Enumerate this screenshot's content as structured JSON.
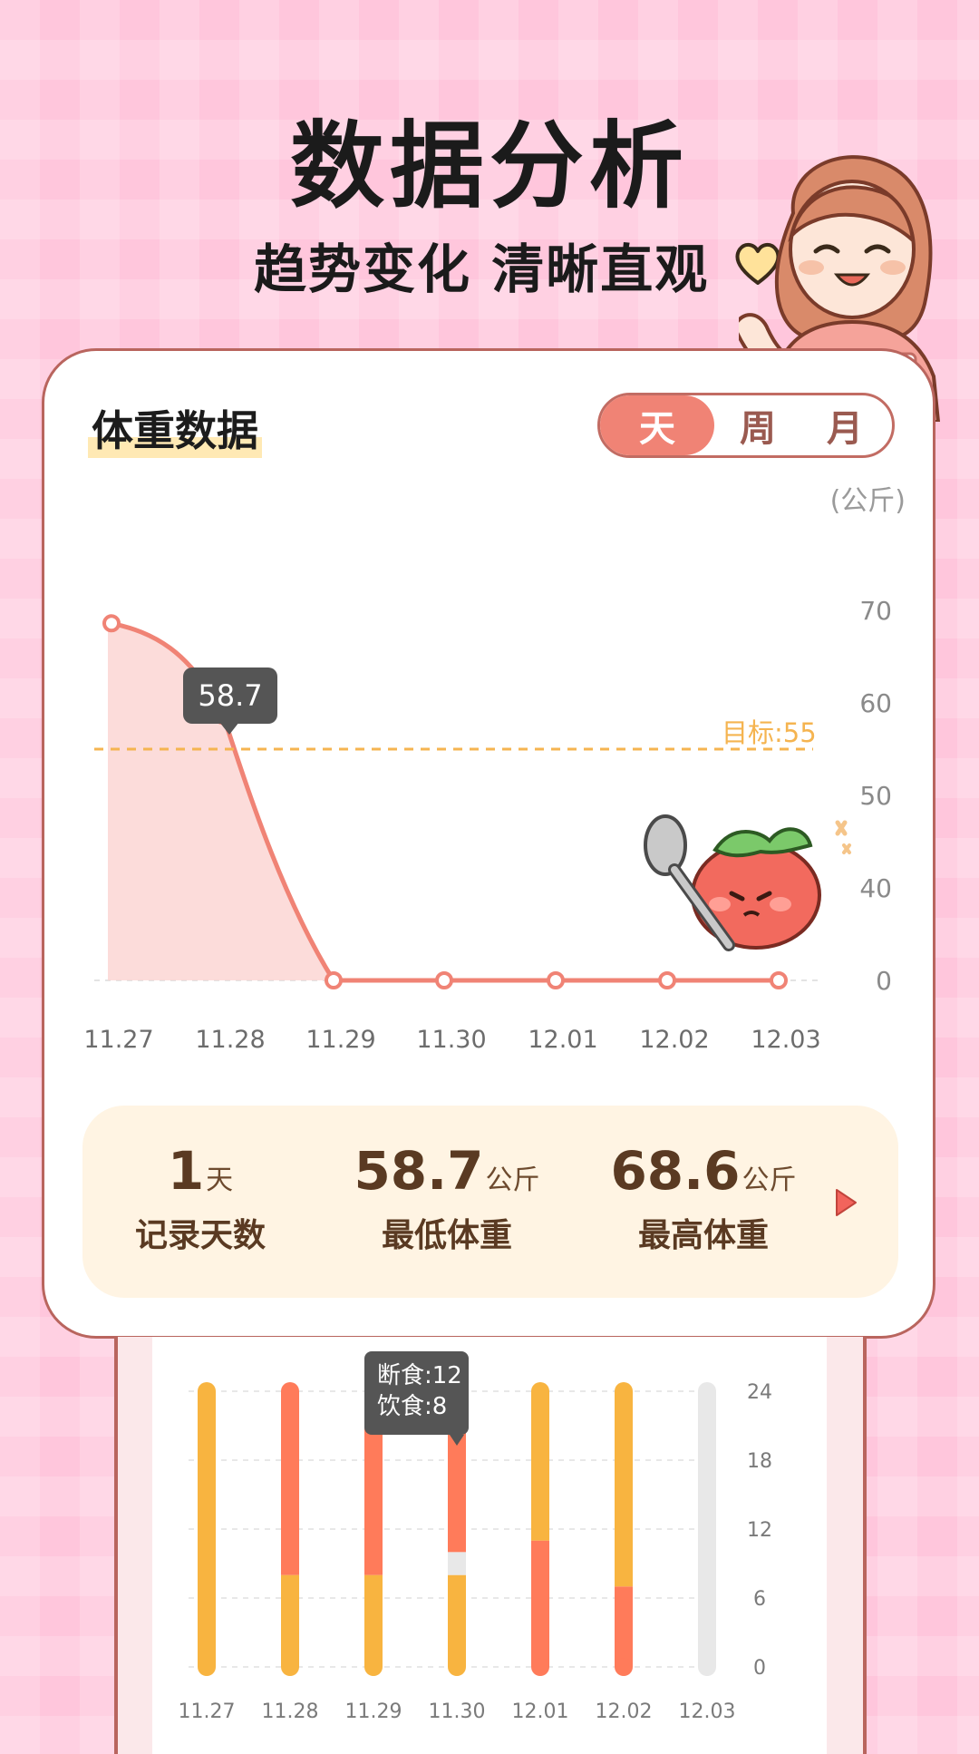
{
  "hero": {
    "title": "数据分析",
    "subtitle": "趋势变化 清晰直观"
  },
  "weight_card": {
    "title": "体重数据",
    "tabs": [
      {
        "label": "天",
        "active": true
      },
      {
        "label": "周",
        "active": false
      },
      {
        "label": "月",
        "active": false
      }
    ],
    "unit": "(公斤)",
    "goal_label": "目标:55",
    "tooltip": "58.7"
  },
  "stats": {
    "days": {
      "value": "1",
      "unit": "天",
      "label": "记录天数"
    },
    "min": {
      "value": "58.7",
      "unit": "公斤",
      "label": "最低体重"
    },
    "max": {
      "value": "68.6",
      "unit": "公斤",
      "label": "最高体重"
    }
  },
  "fasting_card": {
    "tooltip_line1": "断食:12",
    "tooltip_line2": "饮食:8"
  },
  "chart_data": [
    {
      "type": "area",
      "categories": [
        "11.27",
        "11.28",
        "11.29",
        "11.30",
        "12.01",
        "12.02",
        "12.03"
      ],
      "series": [
        {
          "values": [
            68.6,
            58.7,
            0,
            0,
            0,
            0,
            0
          ]
        }
      ],
      "y_ticks": [
        "70",
        "60",
        "50",
        "40",
        "0"
      ],
      "goal": 55,
      "colors": {
        "line": "#f08375",
        "fill": "#fcd6d3",
        "goal": "#f5b450"
      }
    },
    {
      "type": "bar",
      "categories": [
        "11.27",
        "11.28",
        "11.29",
        "11.30",
        "12.01",
        "12.02",
        "12.03"
      ],
      "y_ticks": [
        "24",
        "18",
        "12",
        "6",
        "0"
      ],
      "ylim": [
        0,
        24
      ],
      "bars": [
        [
          {
            "from": 0,
            "to": 24,
            "color": "#f8b440"
          }
        ],
        [
          {
            "from": 0,
            "to": 8,
            "color": "#f8b440"
          },
          {
            "from": 8,
            "to": 24,
            "color": "#ff7b5a"
          }
        ],
        [
          {
            "from": 0,
            "to": 8,
            "color": "#f8b440"
          },
          {
            "from": 8,
            "to": 24,
            "color": "#ff7b5a"
          }
        ],
        [
          {
            "from": 0,
            "to": 8,
            "color": "#f8b440"
          },
          {
            "from": 8,
            "to": 10,
            "color": "#e8e8e8"
          },
          {
            "from": 10,
            "to": 24,
            "color": "#ff7b5a"
          }
        ],
        [
          {
            "from": 0,
            "to": 11,
            "color": "#ff7b5a"
          },
          {
            "from": 11,
            "to": 24,
            "color": "#f8b440"
          }
        ],
        [
          {
            "from": 0,
            "to": 7,
            "color": "#ff7b5a"
          },
          {
            "from": 7,
            "to": 24,
            "color": "#f8b440"
          }
        ],
        [
          {
            "from": 0,
            "to": 24,
            "color": "#e8e8e8"
          }
        ]
      ]
    }
  ]
}
